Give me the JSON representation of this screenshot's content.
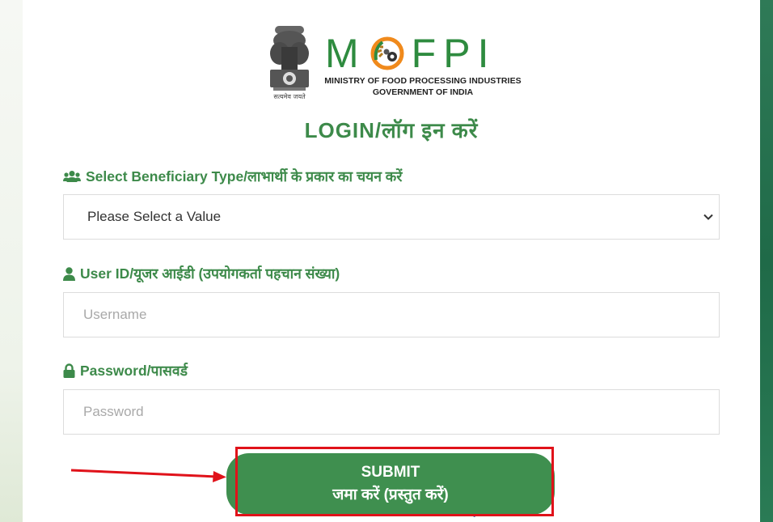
{
  "header": {
    "brand_letters": [
      "M",
      "F",
      "P",
      "I"
    ],
    "ministry": "MINISTRY OF FOOD PROCESSING INDUSTRIES",
    "government": "GOVERNMENT OF INDIA",
    "emblem_motto": "सत्यमेव जयते"
  },
  "login": {
    "title": "LOGIN/लॉग इन करें",
    "beneficiary": {
      "icon": "users-icon",
      "label": "Select Beneficiary Type/लाभार्थी के प्रकार का चयन करें",
      "selected_value": "Please Select a Value"
    },
    "user_id": {
      "icon": "user-icon",
      "label": "User ID/यूजर आईडी (उपयोगकर्ता पहचान संख्या)",
      "placeholder": "Username"
    },
    "password": {
      "icon": "lock-icon",
      "label": "Password/पासवर्ड",
      "placeholder": "Password"
    },
    "submit": {
      "line1": "SUBMIT",
      "line2": "जमा करें (प्रस्तुत करें)"
    }
  },
  "colors": {
    "brand_green": "#3d8a4a",
    "button_green": "#3f8f4f",
    "annotation_red": "#e0121a",
    "ring_orange": "#f08a1c"
  }
}
